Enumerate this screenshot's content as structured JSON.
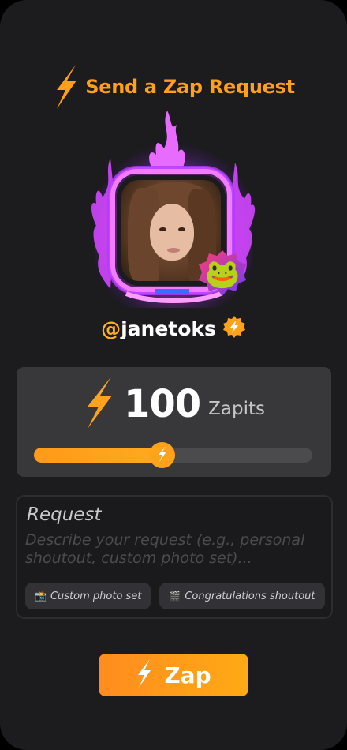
{
  "header": {
    "title": "Send a Zap Request",
    "bolt_icon": "lightning-bolt-icon",
    "accent_color": "#ff9f1a"
  },
  "profile": {
    "username": "janetoks",
    "at_symbol": "@",
    "verified_icon": "verified-badge-icon",
    "avatar_frame": "purple-flame-frame",
    "badge_icon": "frog-badge-icon"
  },
  "amount": {
    "value": "100",
    "unit": "Zapits",
    "slider_level_percent": 46
  },
  "request": {
    "label": "Request",
    "placeholder": "Describe your request (e.g., personal shoutout, custom photo set)...",
    "value": "",
    "suggestions": [
      {
        "icon": "📸",
        "label": "Custom photo set"
      },
      {
        "icon": "🎬",
        "label": "Congratulations shoutout"
      }
    ]
  },
  "submit": {
    "label": "Zap",
    "gradient_start": "#ff8c1f",
    "gradient_end": "#ffaa14"
  }
}
